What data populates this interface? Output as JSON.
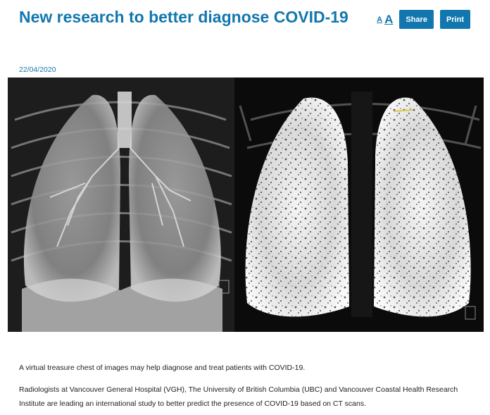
{
  "article": {
    "title": "New research to better diagnose COVID-19",
    "date": "22/04/2020",
    "paragraphs": [
      "A virtual treasure chest of images may help diagnose and treat patients with COVID-19.",
      "Radiologists at Vancouver General Hospital (VGH), The University of British Columbia (UBC) and Vancouver Coastal Health Research Institute are leading an international study to better predict the presence of COVID-19 based on CT scans."
    ]
  },
  "toolbar": {
    "font_small_label": "A",
    "font_large_label": "A",
    "share_label": "Share",
    "print_label": "Print"
  },
  "colors": {
    "brand_blue": "#1277ae",
    "text": "#222222",
    "image_background": "#050505"
  }
}
